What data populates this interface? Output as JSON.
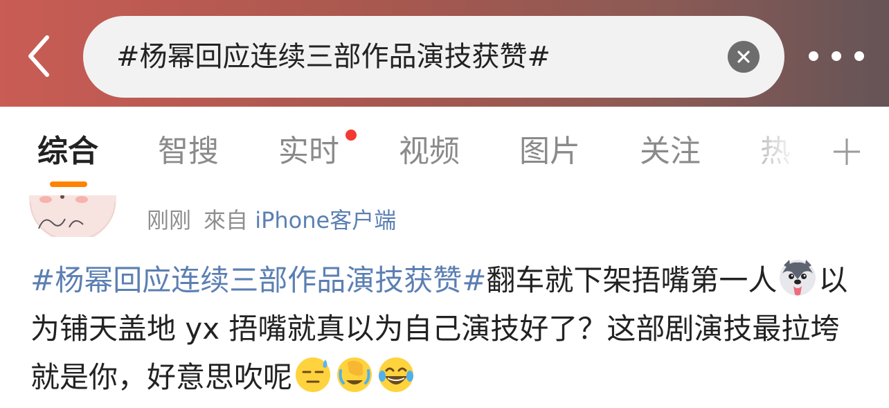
{
  "header": {
    "search_query": "#杨幂回应连续三部作品演技获赞#",
    "back_icon": "chevron-left-icon",
    "clear_icon": "clear-circle-icon",
    "more_icon": "more-dots-icon"
  },
  "tabs": [
    {
      "label": "综合",
      "active": true
    },
    {
      "label": "智搜"
    },
    {
      "label": "实时",
      "has_red_dot": true
    },
    {
      "label": "视频"
    },
    {
      "label": "图片"
    },
    {
      "label": "关注"
    },
    {
      "label": "热"
    }
  ],
  "post": {
    "time": "刚刚",
    "source_prefix": "來自",
    "source": "iPhone客户端",
    "topic": "#杨幂回应连续三部作品演技获赞#",
    "text_1": "翻车就下架捂嘴第一人",
    "text_2": "以为铺天盖地 yx 捂嘴就真以为自己演技好了？这部剧演技最拉垮就是你，好意思吹呢",
    "emojis": [
      "husky-dog-emoji",
      "sweat-face-emoji",
      "facepalm-cry-emoji",
      "laughing-tears-emoji"
    ]
  },
  "colors": {
    "accent": "#ff8200",
    "link": "#5b7fb3",
    "red_dot": "#f23a32"
  }
}
